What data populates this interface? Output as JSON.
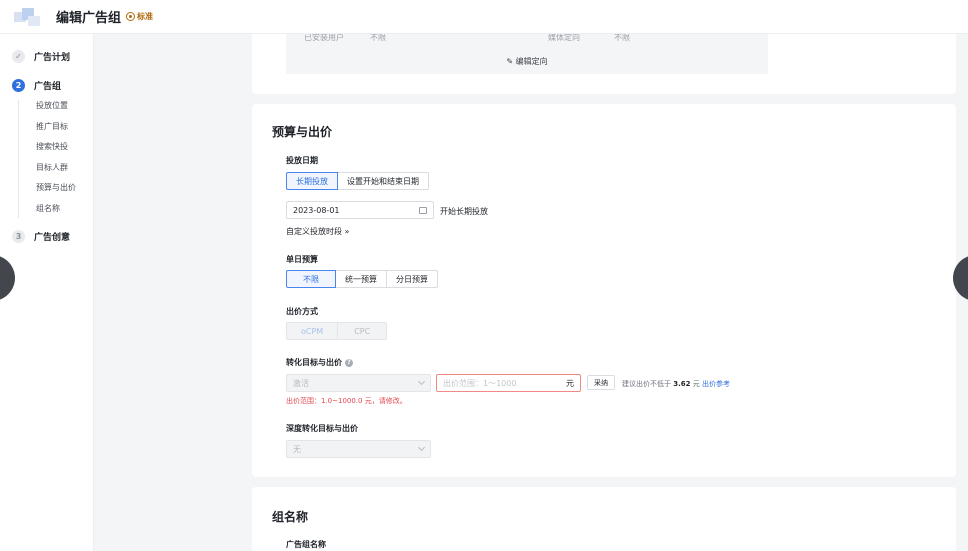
{
  "header": {
    "title": "编辑广告组",
    "badge": "标准"
  },
  "sidebar": {
    "steps": [
      {
        "num": "✓",
        "label": "广告计划"
      },
      {
        "num": "2",
        "label": "广告组"
      },
      {
        "num": "3",
        "label": "广告创意"
      }
    ],
    "sub_items": [
      "投放位置",
      "推广目标",
      "搜索快投",
      "目标人群",
      "预算与出价",
      "组名称"
    ]
  },
  "targeting": {
    "row_label_1": "已安装用户",
    "row_value_1": "不限",
    "row_label_2": "媒体定向",
    "row_value_2": "不限",
    "edit_label": "编辑定向"
  },
  "budget": {
    "title": "预算与出价",
    "date_label": "投放日期",
    "date_options": [
      "长期投放",
      "设置开始和结束日期"
    ],
    "start_date": "2023-08-01",
    "start_hint": "开始长期投放",
    "custom_period": "自定义投放时段",
    "daily_label": "单日预算",
    "daily_options": [
      "不限",
      "统一预算",
      "分日预算"
    ],
    "bid_method_label": "出价方式",
    "bid_methods": [
      "oCPM",
      "CPC"
    ],
    "conv_label": "转化目标与出价",
    "conv_goal": "激活",
    "bid_placeholder": "出价范围：1～1000",
    "bid_unit": "元",
    "adopt_btn": "采纳",
    "suggest_prefix": "建议出价不低于",
    "suggest_value": "3.62",
    "suggest_unit": "元",
    "bid_ref": "出价参考",
    "error_text": "出价范围：1.0~1000.0 元，请修改。",
    "deep_label": "深度转化目标与出价",
    "deep_value": "无"
  },
  "group": {
    "title": "组名称",
    "name_label": "广告组名称"
  }
}
